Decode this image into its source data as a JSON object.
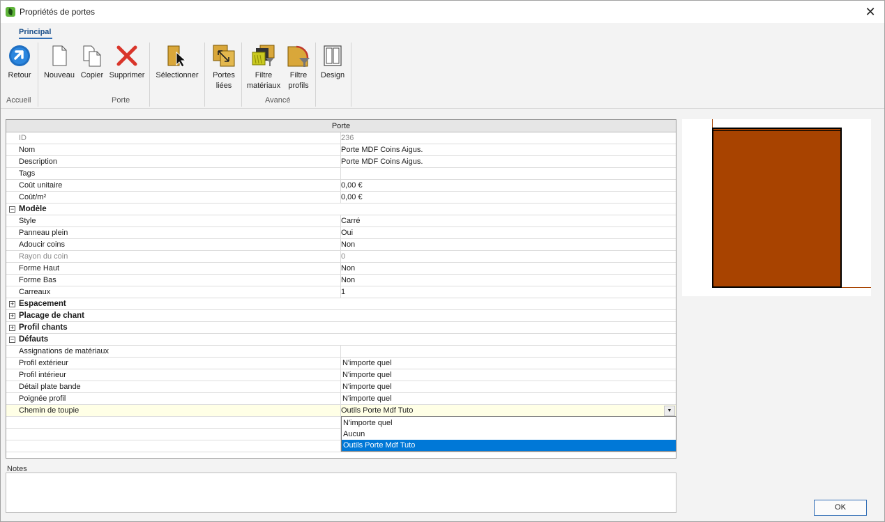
{
  "window": {
    "title": "Propriétés de portes"
  },
  "ribbon": {
    "tab": "Principal",
    "buttons": {
      "retour": "Retour",
      "nouveau": "Nouveau",
      "copier": "Copier",
      "supprimer": "Supprimer",
      "selectionner": "Sélectionner",
      "portes_liees_1": "Portes",
      "portes_liees_2": "liées",
      "filtre_mat_1": "Filtre",
      "filtre_mat_2": "matériaux",
      "filtre_prof_1": "Filtre",
      "filtre_prof_2": "profils",
      "design": "Design"
    },
    "groups": {
      "accueil": "Accueil",
      "porte": "Porte",
      "avance": "Avancé"
    }
  },
  "grid": {
    "header": "Porte",
    "rows": [
      {
        "label": "ID",
        "value": "236"
      },
      {
        "label": "Nom",
        "value": "Porte MDF Coins Aigus."
      },
      {
        "label": "Description",
        "value": "Porte MDF Coins Aigus."
      },
      {
        "label": "Tags",
        "value": ""
      },
      {
        "label": "Coût unitaire",
        "value": "0,00 €"
      },
      {
        "label": "Coût/m²",
        "value": "0,00 €"
      },
      {
        "label": "Modèle",
        "value": ""
      },
      {
        "label": "Style",
        "value": "Carré"
      },
      {
        "label": "Panneau plein",
        "value": "Oui"
      },
      {
        "label": "Adoucir coins",
        "value": "Non"
      },
      {
        "label": "Rayon du coin",
        "value": "0"
      },
      {
        "label": "Forme Haut",
        "value": "Non"
      },
      {
        "label": "Forme Bas",
        "value": "Non"
      },
      {
        "label": "Carreaux",
        "value": "1"
      },
      {
        "label": "Espacement",
        "value": ""
      },
      {
        "label": "Placage de chant",
        "value": ""
      },
      {
        "label": "Profil chants",
        "value": ""
      },
      {
        "label": "Défauts",
        "value": ""
      },
      {
        "label": "Assignations de matériaux",
        "value": ""
      },
      {
        "label": "Profil extérieur",
        "value": "N'importe quel"
      },
      {
        "label": "Profil intérieur",
        "value": "N'importe quel"
      },
      {
        "label": "Détail plate bande",
        "value": "N'importe quel"
      },
      {
        "label": "Poignée profil",
        "value": "N'importe quel"
      },
      {
        "label": "Chemin de toupie",
        "value": "Outils Porte Mdf Tuto"
      }
    ],
    "expander_minus": "−",
    "expander_plus": "+",
    "dropdown_arrow": "▼",
    "dropdown_options": [
      "N'importe quel",
      "Aucun",
      "Outils Porte Mdf Tuto"
    ]
  },
  "notes": {
    "label": "Notes",
    "value": ""
  },
  "footer": {
    "ok": "OK"
  },
  "colors": {
    "door": "#a84300",
    "accent": "#0078d7"
  }
}
